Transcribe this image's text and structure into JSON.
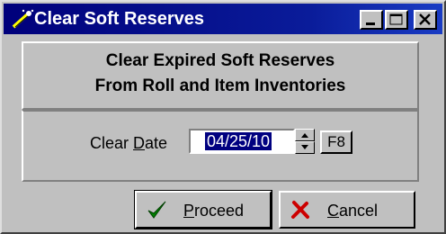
{
  "window": {
    "title": "Clear Soft Reserves"
  },
  "header": {
    "line1": "Clear Expired Soft Reserves",
    "line2": "From Roll and Item Inventories"
  },
  "form": {
    "date_label_prefix": "Clear ",
    "date_label_accel": "D",
    "date_label_rest": "ate",
    "date_value": "04/25/10",
    "f8_label": "F8"
  },
  "buttons": {
    "proceed_accel": "P",
    "proceed_rest": "roceed",
    "cancel_accel": "C",
    "cancel_rest": "ancel"
  },
  "colors": {
    "titlebar": "#00007b",
    "selection": "#000080",
    "proceed_icon": "#008000",
    "cancel_icon": "#cc0000"
  }
}
